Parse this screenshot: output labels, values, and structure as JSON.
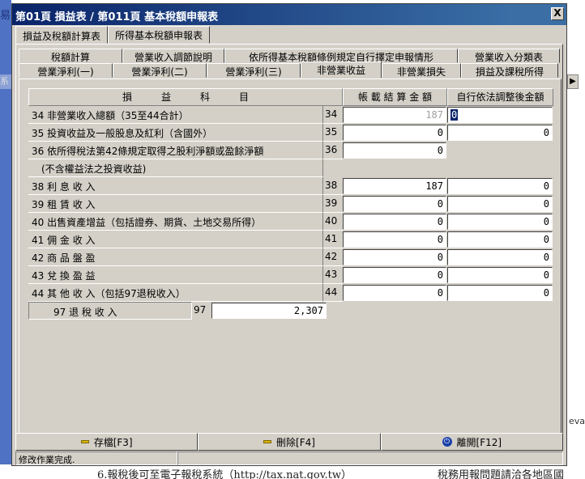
{
  "window": {
    "title": "第01頁 損益表 / 第011頁 基本稅額申報表",
    "close_label": "X"
  },
  "top_tabs": [
    {
      "label": "損益及稅額計算表",
      "active": true
    },
    {
      "label": "所得基本稅額申報表",
      "active": false
    }
  ],
  "tabs_row1": [
    {
      "label": "稅額計算"
    },
    {
      "label": "營業收入調節說明"
    },
    {
      "label": "依所得基本稅額條例規定自行擇定申報情形"
    },
    {
      "label": "營業收入分類表"
    }
  ],
  "tabs_row2": [
    {
      "label": "營業淨利(一)"
    },
    {
      "label": "營業淨利(二)"
    },
    {
      "label": "營業淨利(三)"
    },
    {
      "label": "非營業收益",
      "active": true
    },
    {
      "label": "非營業損失"
    },
    {
      "label": "損益及課稅所得"
    }
  ],
  "table": {
    "header_item": "損　　　益　　　科　　　目",
    "header_book": "帳 載 結 算 金 額",
    "header_adjusted": "自行依法調整後金額",
    "rows": [
      {
        "label": "34 非營業收入總額（35至44合計）",
        "code": "34",
        "book": "187",
        "adjusted": "0"
      },
      {
        "label": "35 投資收益及一般股息及紅利（含國外）",
        "code": "35",
        "book": "0",
        "adjusted": "0"
      },
      {
        "label": "36 依所得稅法第42條規定取得之股利淨額或盈餘淨額",
        "code": "36",
        "book": "0",
        "adjusted": ""
      },
      {
        "label": "　(不含權益法之投資收益)",
        "code": "",
        "book": "",
        "adjusted": ""
      },
      {
        "label": "38 利 息 收 入",
        "code": "38",
        "book": "187",
        "adjusted": "0"
      },
      {
        "label": "39 租 賃 收 入",
        "code": "39",
        "book": "0",
        "adjusted": "0"
      },
      {
        "label": "40 出售資產增益（包括證券、期貨、土地交易所得）",
        "code": "40",
        "book": "0",
        "adjusted": "0"
      },
      {
        "label": "41 佣 金 收 入",
        "code": "41",
        "book": "0",
        "adjusted": "0"
      },
      {
        "label": "42 商 品 盤 盈",
        "code": "42",
        "book": "0",
        "adjusted": "0"
      },
      {
        "label": "43 兌 換 盈 益",
        "code": "43",
        "book": "0",
        "adjusted": "0"
      },
      {
        "label": "44 其 他 收 入（包括97退稅收入）",
        "code": "44",
        "book": "0",
        "adjusted": "0"
      }
    ],
    "row97": {
      "label": "97 退 稅 收 入",
      "code": "97",
      "value": "2,307"
    }
  },
  "buttons": {
    "save": "存檔[F3]",
    "delete": "刪除[F4]",
    "exit": "離開[F12]"
  },
  "status": {
    "message": "修改作業完成.",
    "extra": ""
  },
  "background": {
    "bottom_text_left": "6.報稅後可至電子報稅系統（http://tax.nat.gov.tw）",
    "bottom_text_right": "稅務用報問題請洽各地區國",
    "right_fragments": [
      "eva"
    ]
  }
}
